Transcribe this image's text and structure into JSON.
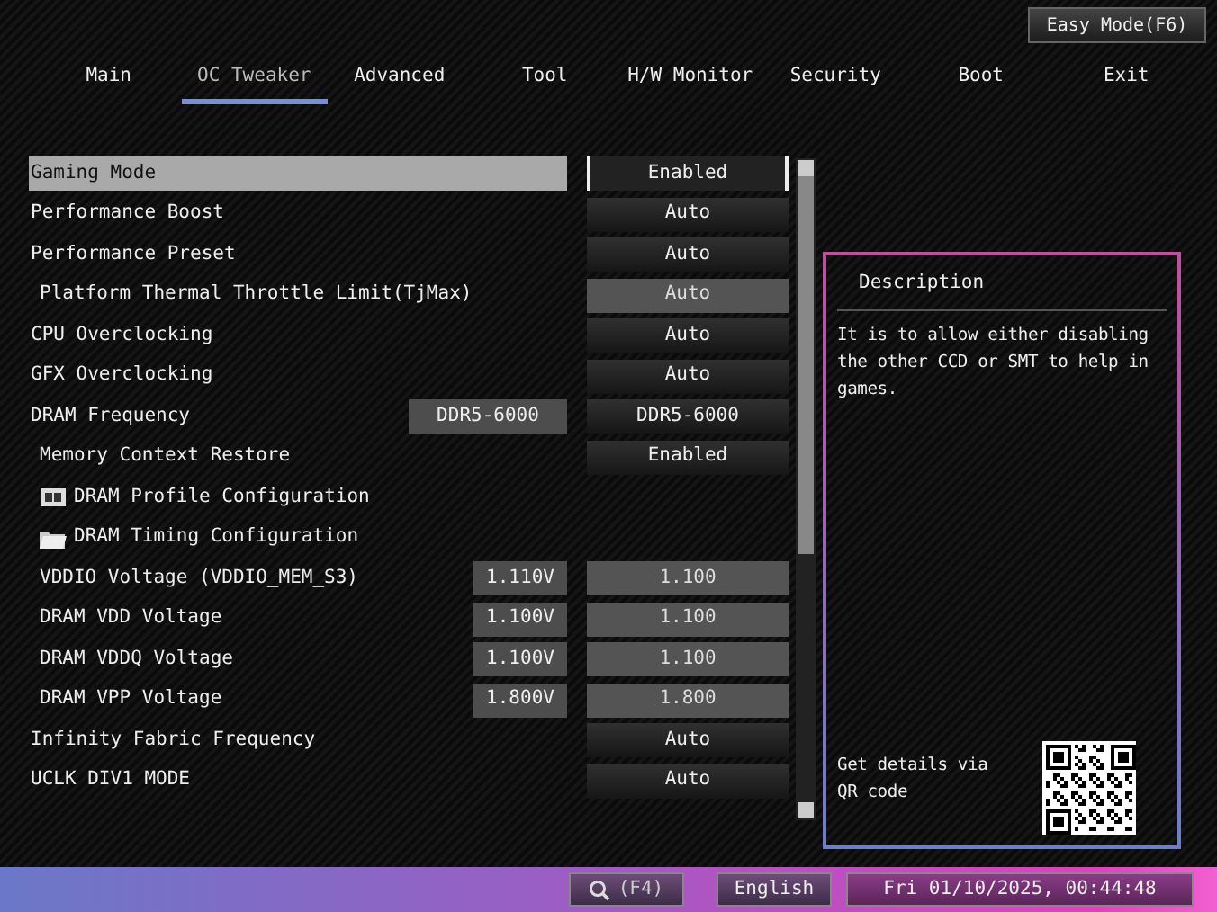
{
  "easy_mode_button": "Easy Mode(F6)",
  "tabs": [
    {
      "label": "Main",
      "selected": false
    },
    {
      "label": "OC Tweaker",
      "selected": true
    },
    {
      "label": "Advanced",
      "selected": false
    },
    {
      "label": "Tool",
      "selected": false
    },
    {
      "label": "H/W Monitor",
      "selected": false
    },
    {
      "label": "Security",
      "selected": false
    },
    {
      "label": "Boot",
      "selected": false
    },
    {
      "label": "Exit",
      "selected": false
    }
  ],
  "settings": [
    {
      "kind": "option",
      "label": "Gaming Mode",
      "value": "Enabled",
      "selected": true,
      "indented": false
    },
    {
      "kind": "option",
      "label": "Performance Boost",
      "value": "Auto",
      "selected": false,
      "indented": false
    },
    {
      "kind": "option",
      "label": "Performance Preset",
      "value": "Auto",
      "selected": false,
      "indented": false
    },
    {
      "kind": "field",
      "label": "Platform Thermal Throttle Limit(TjMax)",
      "value": "Auto",
      "selected": false,
      "indented": true
    },
    {
      "kind": "option",
      "label": "CPU Overclocking",
      "value": "Auto",
      "selected": false,
      "indented": false
    },
    {
      "kind": "option",
      "label": "GFX Overclocking",
      "value": "Auto",
      "selected": false,
      "indented": false
    },
    {
      "kind": "wide-reading",
      "label": "DRAM Frequency",
      "current": "DDR5-6000",
      "value": "DDR5-6000",
      "selected": false,
      "indented": false
    },
    {
      "kind": "option",
      "label": "Memory Context Restore",
      "value": "Enabled",
      "selected": false,
      "indented": true
    },
    {
      "kind": "moduleset",
      "label": "DRAM Profile Configuration",
      "selected": false,
      "indented": true
    },
    {
      "kind": "folder",
      "label": "DRAM Timing Configuration",
      "selected": false,
      "indented": true
    },
    {
      "kind": "reading",
      "label": "VDDIO Voltage (VDDIO_MEM_S3)",
      "current": "1.110V",
      "value": "1.100",
      "selected": false,
      "indented": true
    },
    {
      "kind": "reading",
      "label": "DRAM VDD Voltage",
      "current": "1.100V",
      "value": "1.100",
      "selected": false,
      "indented": true
    },
    {
      "kind": "reading",
      "label": "DRAM VDDQ Voltage",
      "current": "1.100V",
      "value": "1.100",
      "selected": false,
      "indented": true
    },
    {
      "kind": "reading",
      "label": "DRAM VPP Voltage",
      "current": "1.800V",
      "value": "1.800",
      "selected": false,
      "indented": true
    },
    {
      "kind": "option",
      "label": "Infinity Fabric Frequency",
      "value": "Auto",
      "selected": false,
      "indented": false
    },
    {
      "kind": "option",
      "label": "UCLK DIV1 MODE",
      "value": "Auto",
      "selected": false,
      "indented": false
    }
  ],
  "description": {
    "title": "Description",
    "text": "It is to allow either disabling the other CCD or SMT to help in games.",
    "qr_caption": "Get details via QR code"
  },
  "status_bar": {
    "search_key": "(F4)",
    "language": "English",
    "datetime": "Fri 01/10/2025, 00:44:48"
  }
}
